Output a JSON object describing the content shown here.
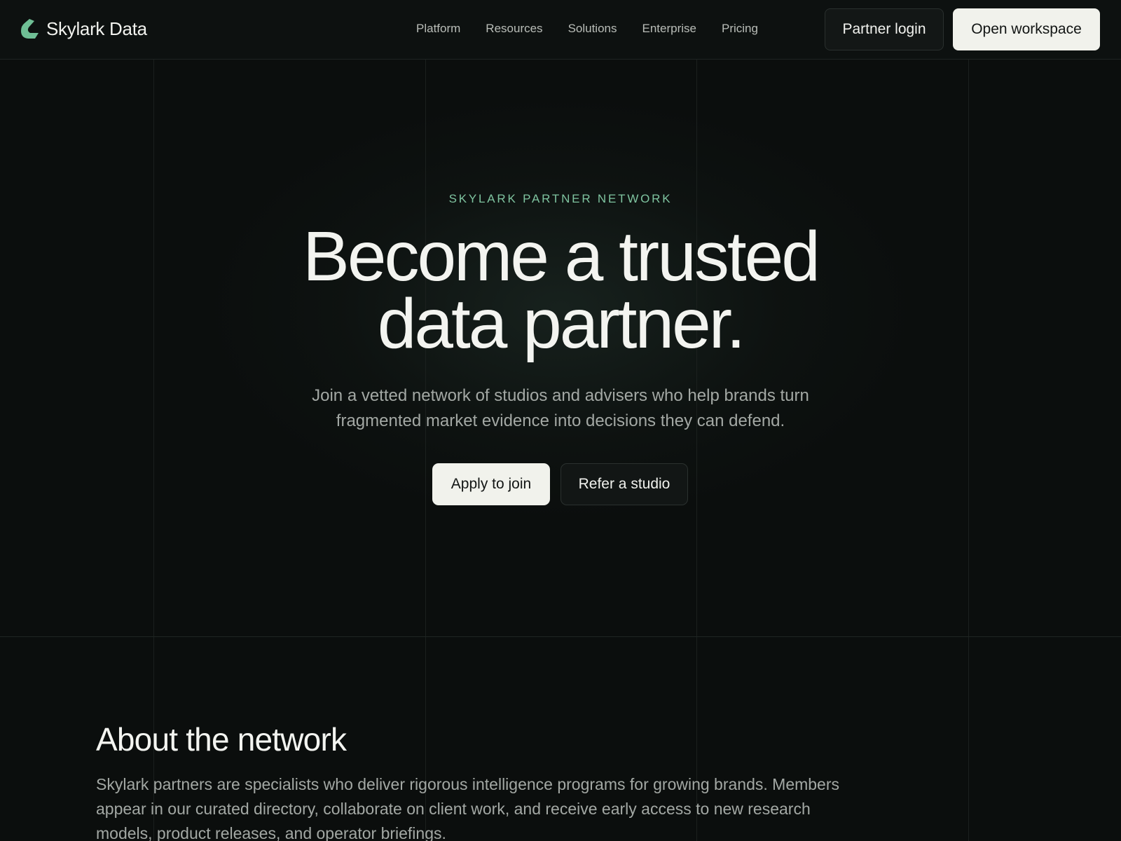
{
  "brand": {
    "name": "Skylark Data",
    "accent_color": "#7fc4a0",
    "logo_icon": "skylark-logo-icon"
  },
  "nav": {
    "items": [
      {
        "label": "Platform"
      },
      {
        "label": "Resources"
      },
      {
        "label": "Solutions"
      },
      {
        "label": "Enterprise"
      },
      {
        "label": "Pricing"
      }
    ]
  },
  "header_actions": {
    "partner_login_label": "Partner login",
    "open_workspace_label": "Open workspace"
  },
  "hero": {
    "eyebrow": "SKYLARK PARTNER NETWORK",
    "title_line1": "Become a trusted",
    "title_line2": "data partner.",
    "subtitle_line1": "Join a vetted network of studios and advisers who help brands turn",
    "subtitle_line2": "fragmented market evidence into decisions they can defend.",
    "primary_cta": "Apply to join",
    "secondary_cta": "Refer a studio"
  },
  "about": {
    "title": "About the network",
    "body": "Skylark partners are specialists who deliver rigorous intelligence programs for growing brands. Members appear in our curated directory, collaborate on client work, and receive early access to new research models, product releases, and operator briefings."
  }
}
